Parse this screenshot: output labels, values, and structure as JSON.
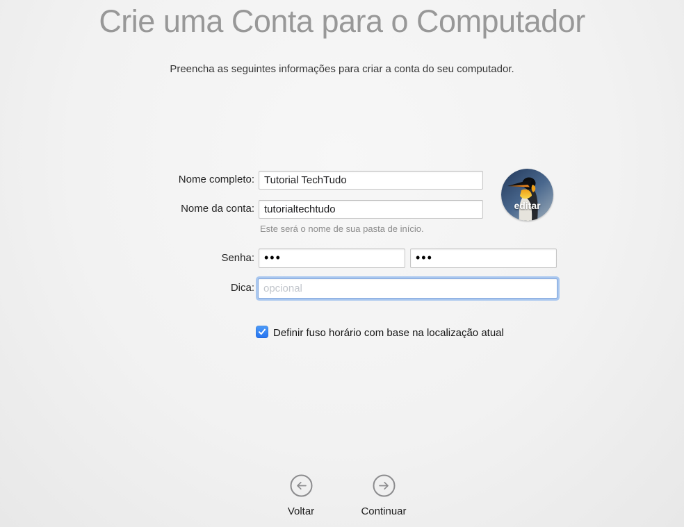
{
  "window": {
    "title": "Crie uma Conta para o Computador",
    "subtitle": "Preencha as seguintes informações para criar a conta do seu computador."
  },
  "form": {
    "full_name": {
      "label": "Nome completo:",
      "value": "Tutorial TechTudo"
    },
    "account_name": {
      "label": "Nome da conta:",
      "value": "tutorialtechtudo",
      "helper": "Este será o nome de sua pasta de início."
    },
    "password": {
      "label": "Senha:",
      "value": "•••",
      "verify_value": "•••"
    },
    "hint": {
      "label": "Dica:",
      "value": "",
      "placeholder": "opcional"
    },
    "timezone": {
      "checked": true,
      "label": "Definir fuso horário com base na localização atual"
    },
    "avatar": {
      "edit_label": "editar",
      "icon": "penguin-avatar"
    }
  },
  "nav": {
    "back": {
      "label": "Voltar",
      "icon": "arrow-left-circle-icon"
    },
    "continue": {
      "label": "Continuar",
      "icon": "arrow-right-circle-icon"
    }
  },
  "colors": {
    "accent_blue": "#2e81f7",
    "focus_ring": "#a9c7ef",
    "title_gray": "#989898",
    "background_top": "#f6f6f6",
    "background_bottom": "#e8e8e8"
  }
}
